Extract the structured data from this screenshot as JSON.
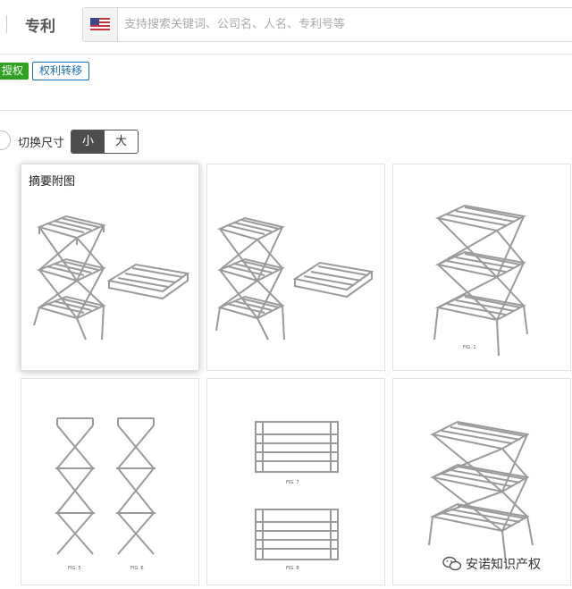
{
  "header": {
    "section_title": "专利",
    "flag_icon": "us-flag-icon",
    "search_placeholder": "支持搜索关键词、公司名、人名、专利号等"
  },
  "tags": {
    "status": "授权",
    "transfer": "权利转移"
  },
  "size_switch": {
    "label": "切换尺寸",
    "small": "小",
    "large": "大",
    "selected": "小"
  },
  "gallery": {
    "abstract_label": "摘要附图",
    "figure_captions": [
      "FIG. 1",
      "FIG. 5",
      "FIG. 6",
      "FIG. 7",
      "FIG. 8"
    ]
  },
  "watermark": {
    "text": "安诺知识产权",
    "icon": "wechat-icon"
  },
  "colors": {
    "tag_green": "#2ea121",
    "tag_blue": "#1b6fb8",
    "toggle_active": "#4d4d4d"
  }
}
